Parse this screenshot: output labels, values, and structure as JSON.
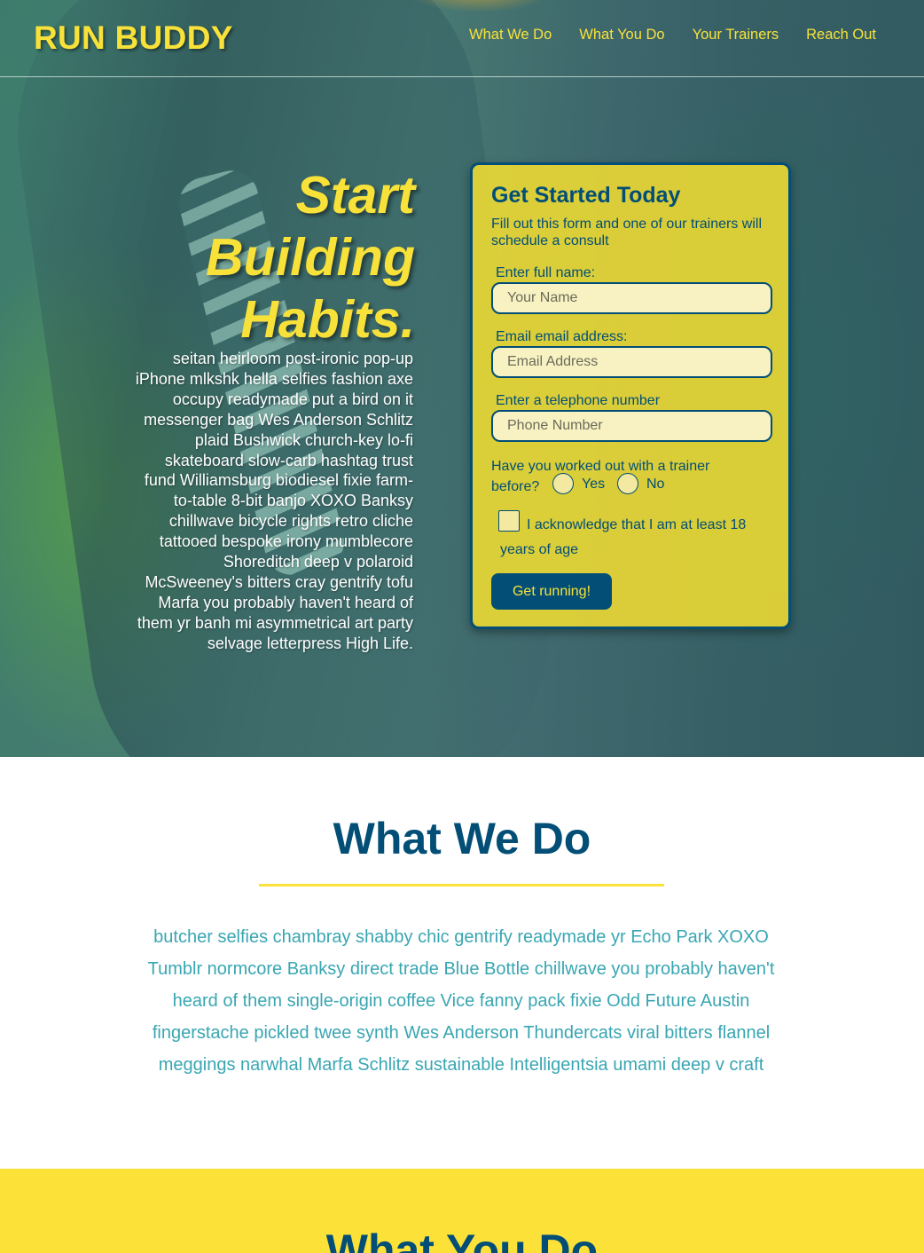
{
  "brand": {
    "logo": "RUN BUDDY"
  },
  "nav": {
    "items": [
      {
        "label": "What We Do"
      },
      {
        "label": "What You Do"
      },
      {
        "label": "Your Trainers"
      },
      {
        "label": "Reach Out"
      }
    ]
  },
  "hero": {
    "title": "Start Building Habits.",
    "body": "seitan heirloom post-ironic pop-up iPhone mlkshk hella selfies fashion axe occupy readymade put a bird on it messenger bag Wes Anderson Schlitz plaid Bushwick church-key lo-fi skateboard slow-carb hashtag trust fund Williamsburg biodiesel fixie farm-to-table 8-bit banjo XOXO Banksy chillwave bicycle rights retro cliche tattooed bespoke irony mumblecore Shoreditch deep v polaroid McSweeney's bitters cray gentrify tofu Marfa you probably haven't heard of them yr banh mi asymmetrical art party selvage letterpress High Life."
  },
  "form": {
    "title": "Get Started Today",
    "subtitle": "Fill out this form and one of our trainers will schedule a consult",
    "name_label": "Enter full name:",
    "name_placeholder": "Your Name",
    "email_label": "Email email address:",
    "email_placeholder": "Email Address",
    "phone_label": "Enter a telephone number",
    "phone_placeholder": "Phone Number",
    "trainer_question": "Have you worked out with a trainer before?",
    "yes_label": "Yes",
    "no_label": "No",
    "acknowledge": "I acknowledge that I am at least 18 years of age",
    "submit_label": "Get running!"
  },
  "what_we_do": {
    "heading": "What We Do",
    "body": "butcher selfies chambray shabby chic gentrify readymade yr Echo Park XOXO Tumblr normcore Banksy direct trade Blue Bottle chillwave you probably haven't heard of them single-origin coffee Vice fanny pack fixie Odd Future Austin fingerstache pickled twee synth Wes Anderson Thundercats viral bitters flannel meggings narwhal Marfa Schlitz sustainable Intelligentsia umami deep v craft"
  },
  "what_you_do": {
    "heading": "What You Do"
  },
  "colors": {
    "primary": "#024e76",
    "accent": "#fce138",
    "teal": "#39a6b2"
  }
}
